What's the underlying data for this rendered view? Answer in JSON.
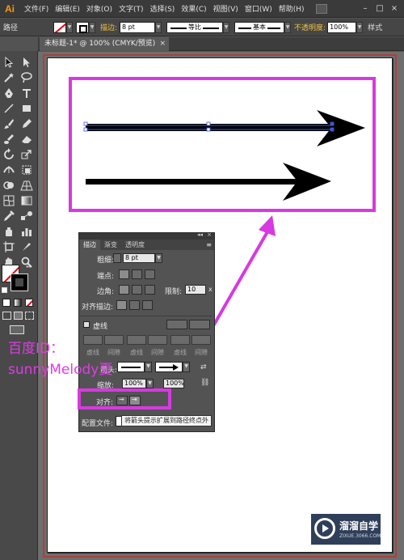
{
  "app": {
    "logo": "Ai"
  },
  "menu": [
    "文件(F)",
    "编辑(E)",
    "对象(O)",
    "文字(T)",
    "选择(S)",
    "效果(C)",
    "视图(V)",
    "窗口(W)",
    "帮助(H)"
  ],
  "window_controls": [
    "–",
    "□",
    "×"
  ],
  "control_bar": {
    "object_type": "路径",
    "stroke_label": "描边:",
    "stroke_weight": "8 pt",
    "profile": "等比",
    "brush": "基本",
    "opacity_label": "不透明度:",
    "opacity": "100%",
    "style_label": "样式"
  },
  "document_tab": {
    "title": "未标题-1* @ 100% (CMYK/预览)",
    "close": "×"
  },
  "stroke_panel": {
    "tabs": [
      "描边",
      "渐变",
      "透明度"
    ],
    "menu_icon": "≡",
    "weight_label": "粗细:",
    "weight_value": "8 pt",
    "cap_label": "端点:",
    "corner_label": "边角:",
    "limit_label": "限制:",
    "limit_value": "10",
    "limit_unit": "x",
    "align_stroke_label": "对齐描边:",
    "dashed_label": "虚线",
    "dash_labels": [
      "虚线",
      "间隙",
      "虚线",
      "间隙",
      "虚线",
      "间隙"
    ],
    "arrow_label": "箭头:",
    "scale_label": "缩放:",
    "scale_start": "100%",
    "scale_end": "100%",
    "align_label": "对齐:",
    "profile_label": "配置文件:"
  },
  "tooltip": "将箭头提示扩展到路径终点外",
  "watermark": {
    "line1": "百度ID：",
    "line2": "sunnyMelody夏"
  },
  "brand": {
    "name": "溜溜自学",
    "url": "ZIXUE.3066.COM"
  },
  "colors": {
    "highlight": "#d63ae0",
    "arrow": "#000000",
    "selection": "#3b5bd6"
  }
}
